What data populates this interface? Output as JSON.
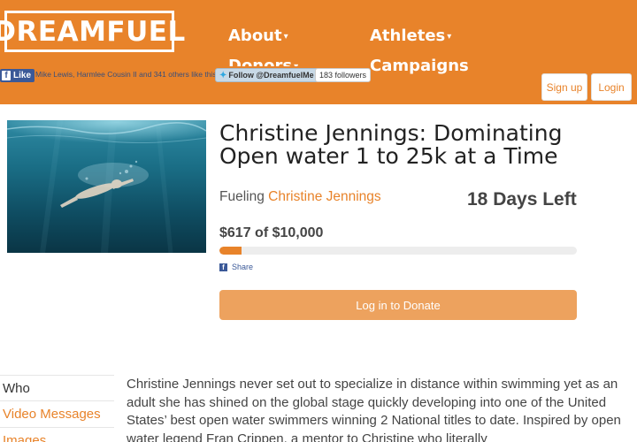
{
  "brand": {
    "logo_text": "DREAMFUEL",
    "accent": "#e8832a"
  },
  "nav": {
    "items": [
      {
        "label": "About",
        "has_dropdown": true
      },
      {
        "label": "Athletes",
        "has_dropdown": true
      },
      {
        "label": "Donors",
        "has_dropdown": true
      },
      {
        "label": "Campaigns",
        "has_dropdown": false
      }
    ],
    "caret": "▾"
  },
  "social": {
    "fb_like_label": "Like",
    "fb_mark": "f",
    "like_text": "Mike Lewis, Harmlee Cousin II and 341 others like this.",
    "twitter_follow_label": "Follow @DreamfuelMe",
    "twitter_followers": "183 followers"
  },
  "auth": {
    "signup_label": "Sign up",
    "login_label": "Login"
  },
  "campaign": {
    "title": "Christine Jennings: Dominating Open water 1 to 25k at a Time",
    "fueling_prefix": "Fueling",
    "athlete_name": "Christine Jennings",
    "days_left": "18 Days Left",
    "raised_text": "$617 of $10,000",
    "progress_fraction": 0.062,
    "share_label": "Share",
    "donate_label": "Log in to Donate"
  },
  "sidebar": {
    "items": [
      {
        "label": "Who"
      },
      {
        "label": "Video Messages"
      },
      {
        "label": "Images"
      }
    ]
  },
  "story": {
    "text": "Christine Jennings never set out to specialize in distance within swimming yet as an adult she has shined on the global stage quickly developing into one of the United States’ best open water swimmers winning 2 National titles to date. Inspired by open water legend Fran Crippen, a mentor to Christine who literally"
  }
}
